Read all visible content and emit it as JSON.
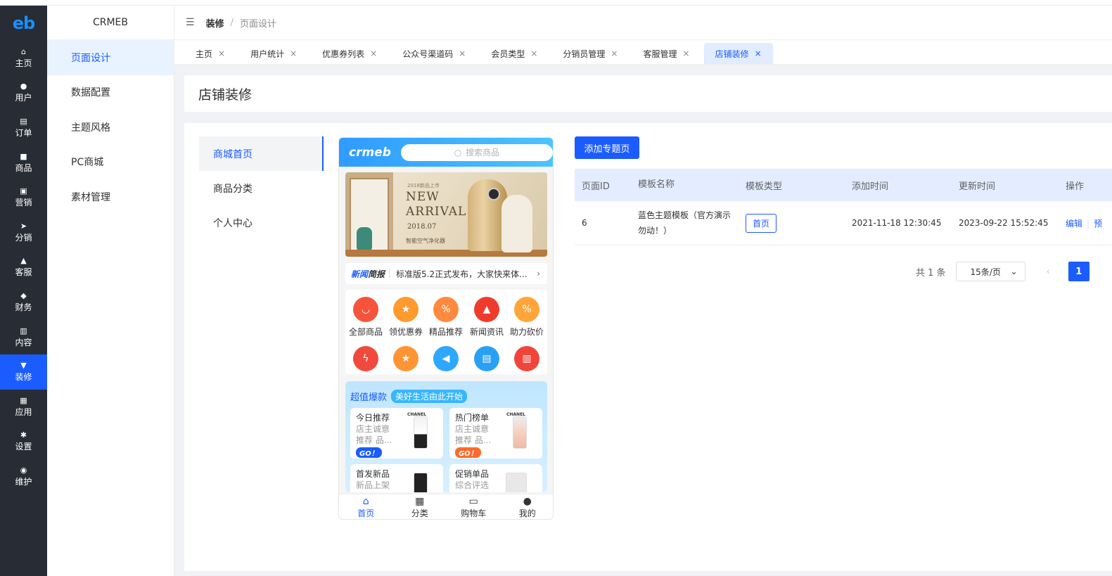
{
  "rail": {
    "logo": "eb",
    "items": [
      {
        "icon": "home-icon",
        "glyph": "⌂",
        "label": "主页"
      },
      {
        "icon": "user-icon",
        "glyph": "●",
        "label": "用户"
      },
      {
        "icon": "order-icon",
        "glyph": "▤",
        "label": "订单"
      },
      {
        "icon": "goods-icon",
        "glyph": "■",
        "label": "商品"
      },
      {
        "icon": "marketing-icon",
        "glyph": "▣",
        "label": "营销"
      },
      {
        "icon": "send-icon",
        "glyph": "➤",
        "label": "分销"
      },
      {
        "icon": "bell-icon",
        "glyph": "▲",
        "label": "客服"
      },
      {
        "icon": "wallet-icon",
        "glyph": "◆",
        "label": "财务"
      },
      {
        "icon": "book-icon",
        "glyph": "▥",
        "label": "内容"
      },
      {
        "icon": "brush-icon",
        "glyph": "▼",
        "label": "装修"
      },
      {
        "icon": "apps-icon",
        "glyph": "▦",
        "label": "应用"
      },
      {
        "icon": "gear-icon",
        "glyph": "✱",
        "label": "设置"
      },
      {
        "icon": "maintain-icon",
        "glyph": "◉",
        "label": "维护"
      }
    ]
  },
  "submenu": {
    "brand": "CRMEB",
    "items": [
      "页面设计",
      "数据配置",
      "主题风格",
      "PC商城",
      "素材管理"
    ]
  },
  "header": {
    "fold_icon": "menu-fold-icon",
    "crumb1": "装修",
    "sep": "/",
    "crumb2": "页面设计"
  },
  "tabs": [
    "主页",
    "用户统计",
    "优惠券列表",
    "公众号渠道码",
    "会员类型",
    "分销员管理",
    "客服管理",
    "店铺装修"
  ],
  "tab_close": "×",
  "page_title": "店铺装修",
  "left_nav": [
    "商城首页",
    "商品分类",
    "个人中心"
  ],
  "phone": {
    "logo": "crmeb",
    "search_placeholder": "搜索商品",
    "banner": {
      "small": "2018新品上市",
      "big1": "NEW",
      "big2": "ARRIVAL",
      "date": "2018.07",
      "cn": "智能空气净化器"
    },
    "news": {
      "label_a": "新闻",
      "label_b": "简报",
      "text": "标准版5.2正式发布，大家快来体...",
      "arrow": "›"
    },
    "categories": [
      "全部商品",
      "领优惠券",
      "精品推荐",
      "新闻资讯",
      "助力砍价"
    ],
    "promo": {
      "title": "超值爆款",
      "tag": "美好生活由此开始",
      "cards": [
        {
          "title": "今日推荐",
          "sub1": "店主诚意",
          "sub2": "推荐 品...",
          "go": "GO！",
          "brand": "CHANEL"
        },
        {
          "title": "热门榜单",
          "sub1": "店主诚意",
          "sub2": "推荐 品...",
          "go": "GO！",
          "brand": "CHANEL"
        },
        {
          "title": "首发新品",
          "sub1": "新品上架",
          "sub2": "",
          "go": "",
          "brand": ""
        },
        {
          "title": "促销单品",
          "sub1": "综合评选",
          "sub2": "",
          "go": "",
          "brand": ""
        }
      ]
    },
    "tabbar": [
      {
        "icon": "home-icon",
        "glyph": "⌂",
        "label": "首页"
      },
      {
        "icon": "category-icon",
        "glyph": "▦",
        "label": "分类"
      },
      {
        "icon": "cart-icon",
        "glyph": "▭",
        "label": "购物车"
      },
      {
        "icon": "profile-icon",
        "glyph": "●",
        "label": "我的"
      }
    ]
  },
  "add_button": "添加专题页",
  "table": {
    "headers": [
      "页面ID",
      "模板名称",
      "模板类型",
      "添加时间",
      "更新时间",
      "操作"
    ],
    "rows": [
      {
        "id": "6",
        "name": "蓝色主题模板（官方演示勿动！）",
        "type": "首页",
        "added": "2021-11-18 12:30:45",
        "updated": "2023-09-22 15:52:45",
        "op1": "编辑",
        "op2": "预"
      }
    ]
  },
  "pager": {
    "total": "共 1 条",
    "size": "15条/页",
    "prev": "‹",
    "page": "1"
  },
  "colors": {
    "accent": "#1b5cff",
    "rail_bg": "#282c35"
  }
}
